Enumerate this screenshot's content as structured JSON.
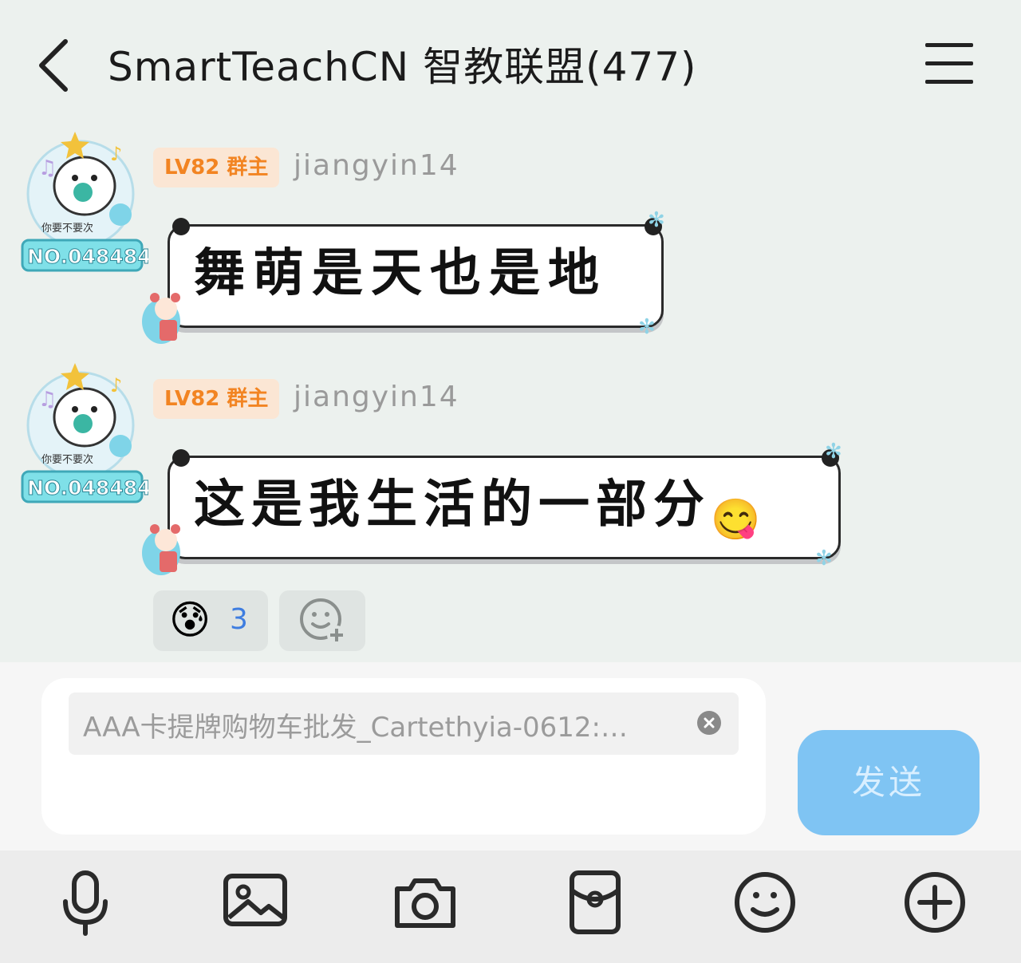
{
  "header": {
    "title": "SmartTeachCN 智教联盟(477)"
  },
  "messages": [
    {
      "level_badge": "LV82 群主",
      "sender": "jiangyin14",
      "text": "舞萌是天也是地",
      "avatar_caption": "你要不要次",
      "avatar_number": "NO.048484"
    },
    {
      "level_badge": "LV82 群主",
      "sender": "jiangyin14",
      "text": "这是我生活的一部分",
      "trailing_emoji": "😋",
      "avatar_caption": "你要不要次",
      "avatar_number": "NO.048484",
      "reactions": [
        {
          "emoji": "😰",
          "count": "3"
        }
      ]
    }
  ],
  "composer": {
    "quote_text": "AAA卡提牌购物车批发_Cartethyia-0612:…",
    "send_label": "发送"
  },
  "toolbar": {
    "items": [
      "microphone-icon",
      "image-icon",
      "camera-icon",
      "red-packet-icon",
      "emoji-icon",
      "plus-icon"
    ]
  },
  "colors": {
    "background": "#ecf1ee",
    "level_badge_bg": "#fbe6d4",
    "level_badge_text": "#f28422",
    "send_button": "#7fc4f3",
    "reaction_count": "#3e7de0"
  }
}
